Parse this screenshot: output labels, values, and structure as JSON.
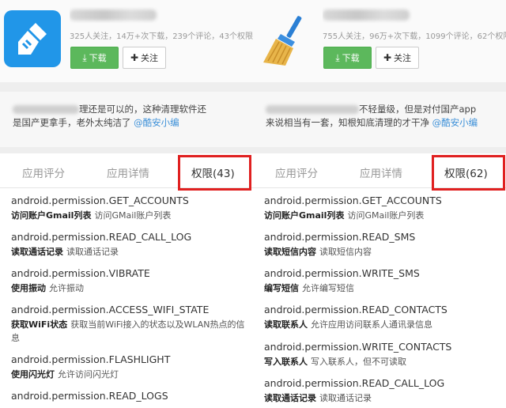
{
  "apps": [
    {
      "stats": "325人关注，14万+次下载，239个评论，43个权限，",
      "download_label": "下载",
      "follow_label": "关注",
      "comment_start": "理还是可以的，这种清理软件还",
      "comment_line2": "是国产更拿手，老外太纯洁了 ",
      "comment_author": "@酷安小编",
      "tabs": [
        "应用评分",
        "应用详情",
        "权限(43)"
      ],
      "permissions": [
        {
          "name": "android.permission.GET_ACCOUNTS",
          "title": "访问账户Gmail列表",
          "desc": "访问GMail账户列表"
        },
        {
          "name": "android.permission.READ_CALL_LOG",
          "title": "读取通话记录",
          "desc": "读取通话记录"
        },
        {
          "name": "android.permission.VIBRATE",
          "title": "使用振动",
          "desc": "允许振动"
        },
        {
          "name": "android.permission.ACCESS_WIFI_STATE",
          "title": "获取WiFi状态",
          "desc": "获取当前WiFi接入的状态以及WLAN热点的信息"
        },
        {
          "name": "android.permission.FLASHLIGHT",
          "title": "使用闪光灯",
          "desc": "允许访问闪光灯"
        },
        {
          "name": "android.permission.READ_LOGS",
          "title": "",
          "desc": ""
        }
      ]
    },
    {
      "stats": "755人关注，96万+次下载，1099个评论，62个权限",
      "download_label": "下载",
      "follow_label": "关注",
      "comment_start": "不轻量级，但是对付国产app",
      "comment_line2": "来说相当有一套，知根知底清理的才干净 ",
      "comment_author": "@酷安小编",
      "tabs": [
        "应用评分",
        "应用详情",
        "权限(62)"
      ],
      "permissions": [
        {
          "name": "android.permission.GET_ACCOUNTS",
          "title": "访问账户Gmail列表",
          "desc": "访问GMail账户列表"
        },
        {
          "name": "android.permission.READ_SMS",
          "title": "读取短信内容",
          "desc": "读取短信内容"
        },
        {
          "name": "android.permission.WRITE_SMS",
          "title": "编写短信",
          "desc": "允许编写短信"
        },
        {
          "name": "android.permission.READ_CONTACTS",
          "title": "读取联系人",
          "desc": "允许应用访问联系人通讯录信息"
        },
        {
          "name": "android.permission.WRITE_CONTACTS",
          "title": "写入联系人",
          "desc": "写入联系人，但不可读取"
        },
        {
          "name": "android.permission.READ_CALL_LOG",
          "title": "读取通话记录",
          "desc": "读取通话记录"
        }
      ]
    }
  ],
  "colors": {
    "download_green": "#5cb85c",
    "highlight_red": "#e02020",
    "author_blue": "#3b8fd8",
    "left_icon_blue": "#2196e8"
  },
  "icons": {
    "download": "download-icon",
    "follow": "plus-icon"
  }
}
